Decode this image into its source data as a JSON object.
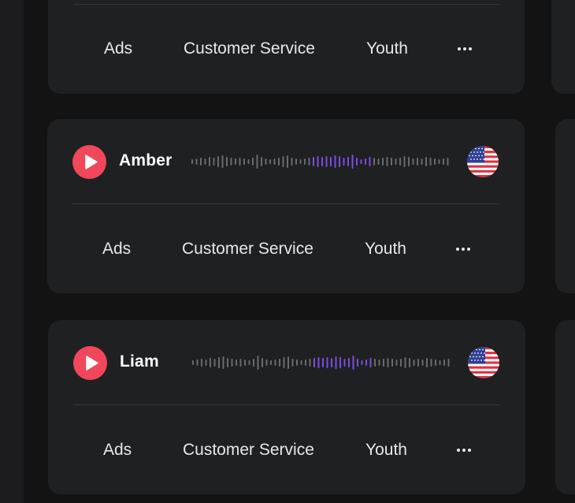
{
  "colors": {
    "background": "#131314",
    "card": "#1f2022",
    "play_accent": "#f0475a",
    "wave_idle": "#6a6a70",
    "wave_active": "#7b4de0"
  },
  "cards": [
    {
      "name": "",
      "tags": [
        "Ads",
        "Customer Service",
        "Youth"
      ],
      "more_icon": "more-horizontal-icon"
    },
    {
      "name": "Amber",
      "play_icon": "play-icon",
      "flag_icon": "us-flag-icon",
      "tags": [
        "Ads",
        "Customer Service",
        "Youth"
      ],
      "more_icon": "more-horizontal-icon"
    },
    {
      "name": "Liam",
      "play_icon": "play-icon",
      "flag_icon": "us-flag-icon",
      "tags": [
        "Ads",
        "Customer Service",
        "Youth"
      ],
      "more_icon": "more-horizontal-icon"
    }
  ]
}
